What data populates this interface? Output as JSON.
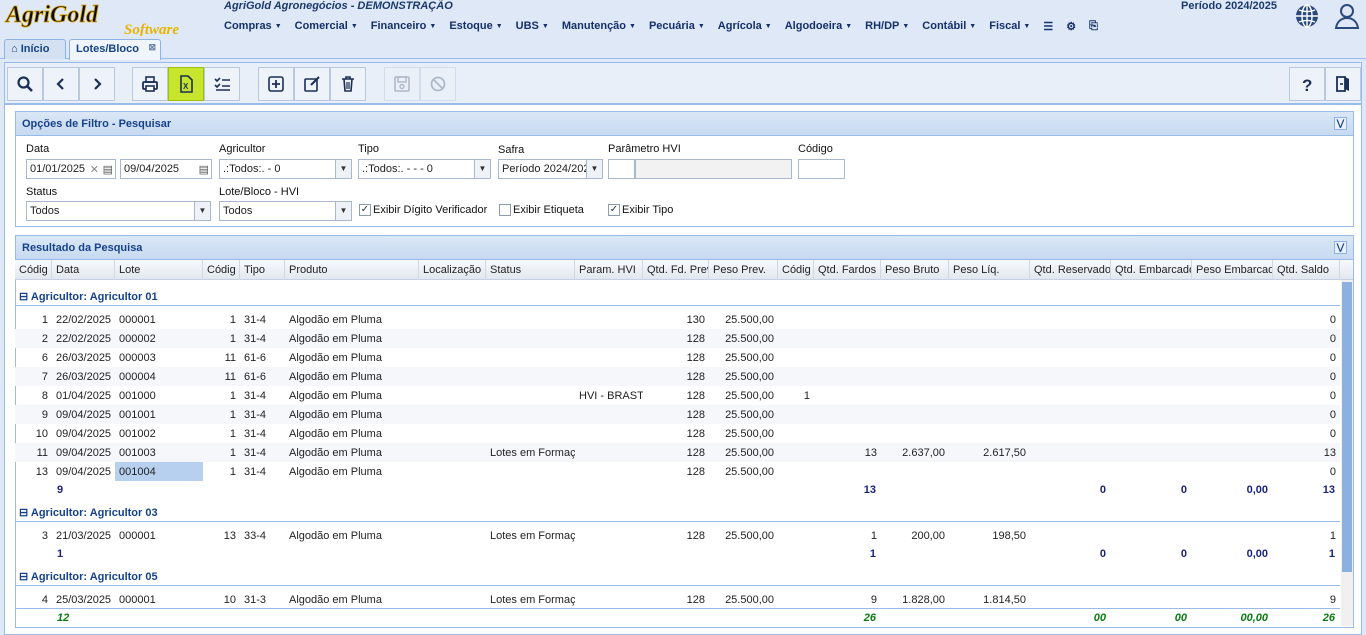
{
  "app": {
    "logo_text": "AgriGold",
    "logo_sub": "Software",
    "company": "AgriGold Agronegócios - DEMONSTRAÇÃO",
    "periodo": "Período 2024/2025"
  },
  "menu": [
    "Compras",
    "Comercial",
    "Financeiro",
    "Estoque",
    "UBS",
    "Manutenção",
    "Pecuária",
    "Agrícola",
    "Algodoeira",
    "RH/DP",
    "Contábil",
    "Fiscal"
  ],
  "tabs": {
    "home": "Início",
    "active": "Lotes/Bloco"
  },
  "filter": {
    "title": "Opções de Filtro - Pesquisar",
    "data_label": "Data",
    "data_from": "01/01/2025",
    "data_to": "09/04/2025",
    "agricultor_label": "Agricultor",
    "agricultor_value": ".:Todos:. - 0",
    "tipo_label": "Tipo",
    "tipo_value": ".:Todos:. -  -  - 0",
    "safra_label": "Safra",
    "safra_value": "Período 2024/2025",
    "hvi_label": "Parâmetro HVI",
    "codigo_label": "Código",
    "status_label": "Status",
    "status_value": "Todos",
    "lote_label": "Lote/Bloco - HVI",
    "lote_value": "Todos",
    "chk_digito": "Exibir Dígito Verificador",
    "chk_etiqueta": "Exibir Etiqueta",
    "chk_tipo": "Exibir Tipo"
  },
  "results": {
    "title": "Resultado da Pesquisa",
    "columns": [
      "Códig",
      "Data",
      "Lote",
      "Códig",
      "Tipo",
      "Produto",
      "Localização",
      "Status",
      "Param. HVI",
      "Qtd. Fd. Prev",
      "Peso Prev.",
      "Códig",
      "Qtd. Fardos",
      "Peso Bruto",
      "Peso Líq.",
      "Qtd. Reservado",
      "Qtd. Embarcado",
      "Peso Embarcado",
      "Qtd. Saldo"
    ],
    "groups": [
      {
        "title": "Agricultor: Agricultor 01",
        "rows": [
          [
            "1",
            "22/02/2025",
            "000001",
            "1",
            "31-4",
            "Algodão em Pluma",
            "",
            "",
            "",
            "130",
            "25.500,00",
            "",
            "",
            "",
            "",
            "",
            "",
            "",
            "0"
          ],
          [
            "2",
            "22/02/2025",
            "000002",
            "1",
            "31-4",
            "Algodão em Pluma",
            "",
            "",
            "",
            "128",
            "25.500,00",
            "",
            "",
            "",
            "",
            "",
            "",
            "",
            "0"
          ],
          [
            "6",
            "26/03/2025",
            "000003",
            "11",
            "61-6",
            "Algodão em Pluma",
            "",
            "",
            "",
            "128",
            "25.500,00",
            "",
            "",
            "",
            "",
            "",
            "",
            "",
            "0"
          ],
          [
            "7",
            "26/03/2025",
            "000004",
            "11",
            "61-6",
            "Algodão em Pluma",
            "",
            "",
            "",
            "128",
            "25.500,00",
            "",
            "",
            "",
            "",
            "",
            "",
            "",
            "0"
          ],
          [
            "8",
            "01/04/2025",
            "001000",
            "1",
            "31-4",
            "Algodão em Pluma",
            "",
            "",
            "HVI - BRASTE",
            "128",
            "25.500,00",
            "1",
            "",
            "",
            "",
            "",
            "",
            "",
            "0"
          ],
          [
            "9",
            "09/04/2025",
            "001001",
            "1",
            "31-4",
            "Algodão em Pluma",
            "",
            "",
            "",
            "128",
            "25.500,00",
            "",
            "",
            "",
            "",
            "",
            "",
            "",
            "0"
          ],
          [
            "10",
            "09/04/2025",
            "001002",
            "1",
            "31-4",
            "Algodão em Pluma",
            "",
            "",
            "",
            "128",
            "25.500,00",
            "",
            "",
            "",
            "",
            "",
            "",
            "",
            "0"
          ],
          [
            "11",
            "09/04/2025",
            "001003",
            "1",
            "31-4",
            "Algodão em Pluma",
            "",
            "Lotes em Formação",
            "",
            "128",
            "25.500,00",
            "",
            "13",
            "2.637,00",
            "2.617,50",
            "",
            "",
            "",
            "13"
          ],
          [
            "13",
            "09/04/2025",
            "001004",
            "1",
            "31-4",
            "Algodão em Pluma",
            "",
            "",
            "",
            "128",
            "25.500,00",
            "",
            "",
            "",
            "",
            "",
            "",
            "",
            "0"
          ]
        ],
        "summary": {
          "count": "9",
          "fardos": "13",
          "reservado": "0",
          "embarcado": "0",
          "peso_emb": "0,00",
          "saldo": "13"
        }
      },
      {
        "title": "Agricultor: Agricultor 03",
        "rows": [
          [
            "3",
            "21/03/2025",
            "000001",
            "13",
            "33-4",
            "Algodão em Pluma",
            "",
            "Lotes em Formação",
            "",
            "128",
            "25.500,00",
            "",
            "1",
            "200,00",
            "198,50",
            "",
            "",
            "",
            "1"
          ]
        ],
        "summary": {
          "count": "1",
          "fardos": "1",
          "reservado": "0",
          "embarcado": "0",
          "peso_emb": "0,00",
          "saldo": "1"
        }
      },
      {
        "title": "Agricultor: Agricultor 05",
        "rows": [
          [
            "4",
            "25/03/2025",
            "000001",
            "10",
            "31-3",
            "Algodão em Pluma",
            "",
            "Lotes em Formação",
            "",
            "128",
            "25.500,00",
            "",
            "9",
            "1.828,00",
            "1.814,50",
            "",
            "",
            "",
            "9"
          ]
        ]
      }
    ],
    "total": {
      "count": "12",
      "fardos": "26",
      "reservado": "00",
      "embarcado": "00",
      "peso_emb": "00,00",
      "saldo": "26"
    }
  },
  "colors": {
    "accent": "#15428b",
    "highlight": "#c7e52c",
    "total": "#0a7a12"
  }
}
